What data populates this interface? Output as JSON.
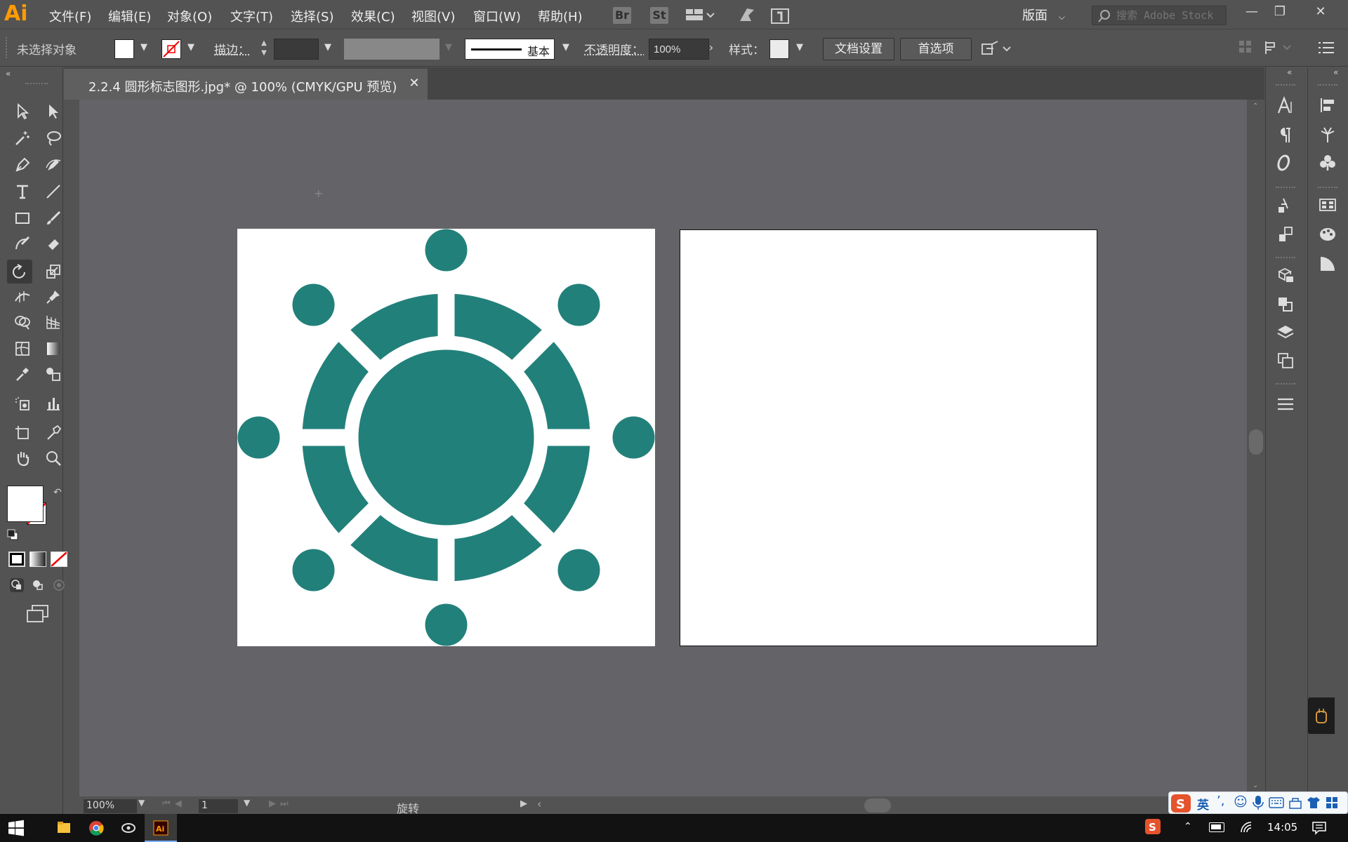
{
  "app": {
    "logo": "Ai",
    "menu": [
      "文件(F)",
      "编辑(E)",
      "对象(O)",
      "文字(T)",
      "选择(S)",
      "效果(C)",
      "视图(V)",
      "窗口(W)",
      "帮助(H)"
    ],
    "bridge_label": "Br",
    "stock_label": "St",
    "workspace": "版面",
    "search_placeholder": "搜索 Adobe Stock"
  },
  "control_bar": {
    "selection_status": "未选择对象",
    "stroke_label": "描边：",
    "profile_label": "基本",
    "opacity_label": "不透明度：",
    "opacity_value": "100%",
    "style_label": "样式：",
    "doc_setup_button": "文档设置",
    "preferences_button": "首选项"
  },
  "document": {
    "tab_title": "2.2.4 圆形标志图形.jpg* @ 100% (CMYK/GPU 预览)"
  },
  "artwork": {
    "fill_color": "#22807a",
    "left_artboard": "circular logo: central disc, segmented ring of 8 arcs, 8 outer dots",
    "right_artboard": "blank"
  },
  "status_bar": {
    "zoom": "100%",
    "artboard_number": "1",
    "current_tool": "旋转"
  },
  "taskbar": {
    "ime_language": "英",
    "time": "14:05"
  }
}
